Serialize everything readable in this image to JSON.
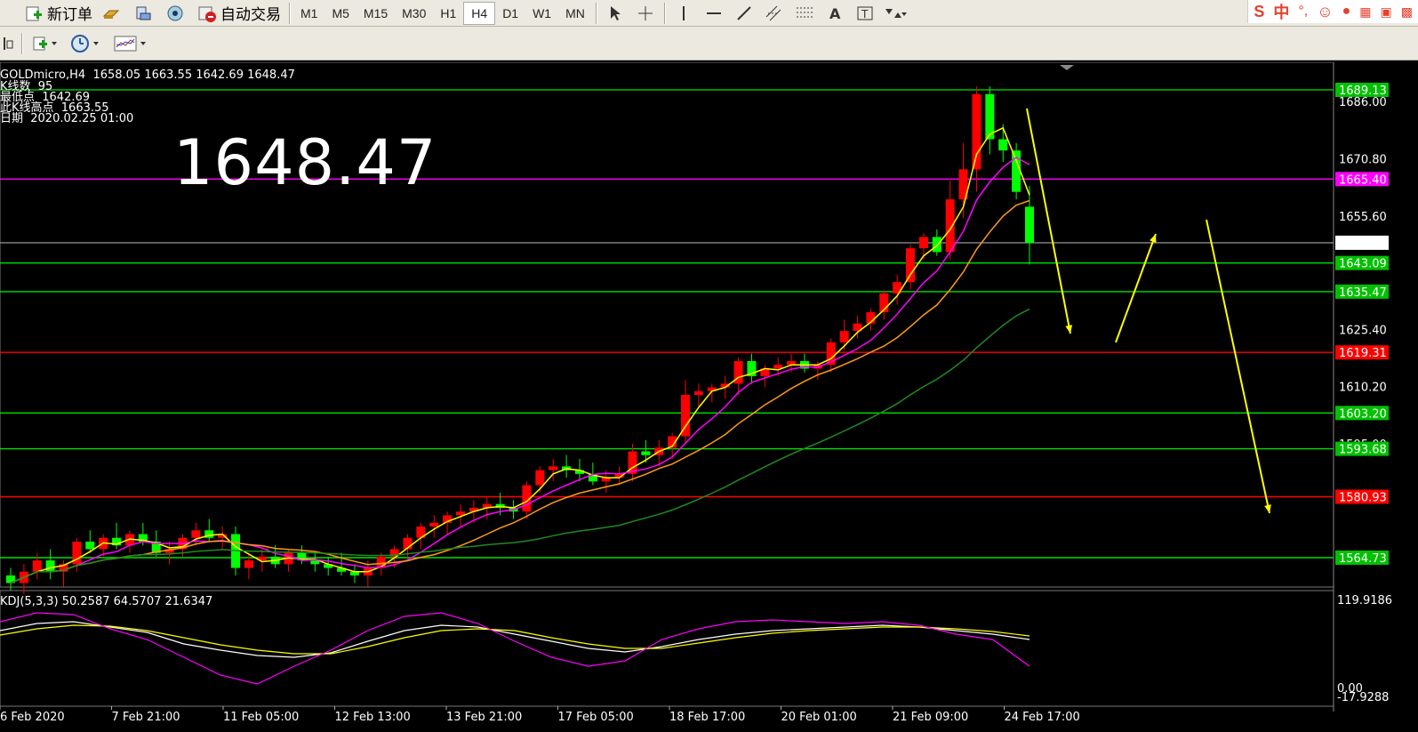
{
  "toolbar1": {
    "new_order_label": "新订单",
    "auto_trade_label": "自动交易",
    "timeframes": [
      "M1",
      "M5",
      "M15",
      "M30",
      "H1",
      "H4",
      "D1",
      "W1",
      "MN"
    ],
    "active_timeframe": "H4",
    "ime_label": "中"
  },
  "chart": {
    "header": "GOLDmicro,H4  1658.05 1663.55 1642.69 1648.47",
    "info_lines": [
      "K线数  95",
      "最低点  1642.69",
      "此K线高点  1663.55",
      "日期  2020.02.25 01:00"
    ],
    "big_price": "1648.47",
    "price_labels": [
      {
        "text": "1689.13",
        "value": 1689.13,
        "bg": "#00c000"
      },
      {
        "text": "1686.00",
        "value": 1686.0,
        "bg": null
      },
      {
        "text": "1670.80",
        "value": 1670.8,
        "bg": null
      },
      {
        "text": "1665.40",
        "value": 1665.4,
        "bg": "#ff00ff"
      },
      {
        "text": "1655.60",
        "value": 1655.6,
        "bg": null
      },
      {
        "text": "1648.47",
        "value": 1648.47,
        "bg": "#ffffff"
      },
      {
        "text": "1643.09",
        "value": 1643.09,
        "bg": "#00c000"
      },
      {
        "text": "1635.47",
        "value": 1635.47,
        "bg": "#00c000"
      },
      {
        "text": "1625.40",
        "value": 1625.4,
        "bg": null
      },
      {
        "text": "1619.31",
        "value": 1619.31,
        "bg": "#ff0000"
      },
      {
        "text": "1610.20",
        "value": 1610.2,
        "bg": null
      },
      {
        "text": "1603.20",
        "value": 1603.2,
        "bg": "#00c000"
      },
      {
        "text": "1595.00",
        "value": 1595.0,
        "bg": null
      },
      {
        "text": "1593.68",
        "value": 1593.68,
        "bg": "#00c000"
      },
      {
        "text": "1580.93",
        "value": 1580.93,
        "bg": "#ff0000"
      },
      {
        "text": "1564.73",
        "value": 1564.73,
        "bg": "#00c000"
      }
    ],
    "hlines": [
      {
        "value": 1689.13,
        "color": "#00c000"
      },
      {
        "value": 1665.4,
        "color": "#ff00ff"
      },
      {
        "value": 1648.47,
        "color": "#8a8a8a"
      },
      {
        "value": 1643.09,
        "color": "#00e000"
      },
      {
        "value": 1635.47,
        "color": "#00e000"
      },
      {
        "value": 1619.31,
        "color": "#ff0000"
      },
      {
        "value": 1603.2,
        "color": "#00e000"
      },
      {
        "value": 1593.68,
        "color": "#00e000"
      },
      {
        "value": 1580.93,
        "color": "#ff0000"
      },
      {
        "value": 1564.73,
        "color": "#00e000"
      }
    ],
    "time_labels": [
      "6 Feb 2020",
      "7 Feb 21:00",
      "11 Feb 05:00",
      "12 Feb 13:00",
      "13 Feb 21:00",
      "17 Feb 05:00",
      "18 Feb 17:00",
      "20 Feb 01:00",
      "21 Feb 09:00",
      "24 Feb 17:00"
    ],
    "kdj": {
      "label": "KDJ(5,3,3) 50.2587 64.5707 21.6347",
      "axis_top": "119.9186",
      "axis_zero": "0.00",
      "axis_bottom": "-17.9288"
    }
  },
  "chart_data": {
    "type": "candlestick",
    "symbol": "GOLDmicro",
    "timeframe": "H4",
    "ylim": [
      1553,
      1695
    ],
    "ohlc": [
      [
        1560,
        1562,
        1556,
        1558
      ],
      [
        1558,
        1563,
        1555,
        1561
      ],
      [
        1561,
        1566,
        1559,
        1564
      ],
      [
        1564,
        1567,
        1559,
        1561
      ],
      [
        1561,
        1564,
        1557,
        1563
      ],
      [
        1563,
        1570,
        1561,
        1569
      ],
      [
        1569,
        1572,
        1566,
        1567
      ],
      [
        1567,
        1571,
        1565,
        1570
      ],
      [
        1570,
        1574,
        1567,
        1568
      ],
      [
        1568,
        1572,
        1566,
        1571
      ],
      [
        1571,
        1574,
        1568,
        1569
      ],
      [
        1569,
        1572,
        1565,
        1566
      ],
      [
        1566,
        1569,
        1563,
        1567
      ],
      [
        1567,
        1571,
        1565,
        1570
      ],
      [
        1570,
        1574,
        1568,
        1572
      ],
      [
        1572,
        1575,
        1569,
        1570
      ],
      [
        1570,
        1573,
        1567,
        1571
      ],
      [
        1571,
        1573,
        1560,
        1562
      ],
      [
        1562,
        1566,
        1559,
        1564
      ],
      [
        1564,
        1567,
        1561,
        1565
      ],
      [
        1565,
        1568,
        1562,
        1563
      ],
      [
        1563,
        1567,
        1561,
        1566
      ],
      [
        1566,
        1568,
        1563,
        1564
      ],
      [
        1564,
        1566,
        1561,
        1563
      ],
      [
        1563,
        1565,
        1560,
        1562
      ],
      [
        1562,
        1566,
        1560,
        1561
      ],
      [
        1561,
        1563,
        1558,
        1560
      ],
      [
        1560,
        1564,
        1557,
        1562
      ],
      [
        1562,
        1566,
        1560,
        1565
      ],
      [
        1565,
        1568,
        1562,
        1567
      ],
      [
        1567,
        1571,
        1565,
        1570
      ],
      [
        1570,
        1574,
        1567,
        1573
      ],
      [
        1573,
        1576,
        1570,
        1574
      ],
      [
        1574,
        1577,
        1571,
        1576
      ],
      [
        1576,
        1579,
        1573,
        1577
      ],
      [
        1577,
        1580,
        1574,
        1578
      ],
      [
        1578,
        1581,
        1575,
        1579
      ],
      [
        1579,
        1582,
        1576,
        1578
      ],
      [
        1578,
        1580,
        1575,
        1577
      ],
      [
        1577,
        1585,
        1575,
        1584
      ],
      [
        1584,
        1589,
        1582,
        1588
      ],
      [
        1588,
        1591,
        1585,
        1589
      ],
      [
        1589,
        1592,
        1586,
        1588
      ],
      [
        1588,
        1591,
        1585,
        1587
      ],
      [
        1587,
        1590,
        1584,
        1585
      ],
      [
        1585,
        1588,
        1582,
        1586
      ],
      [
        1586,
        1589,
        1584,
        1587
      ],
      [
        1587,
        1595,
        1585,
        1593
      ],
      [
        1593,
        1596,
        1590,
        1592
      ],
      [
        1592,
        1596,
        1589,
        1594
      ],
      [
        1594,
        1598,
        1591,
        1597
      ],
      [
        1597,
        1612,
        1595,
        1608
      ],
      [
        1608,
        1611,
        1605,
        1609
      ],
      [
        1609,
        1611,
        1606,
        1610
      ],
      [
        1610,
        1613,
        1607,
        1611
      ],
      [
        1611,
        1618,
        1608,
        1617
      ],
      [
        1617,
        1619,
        1611,
        1613
      ],
      [
        1613,
        1616,
        1610,
        1615
      ],
      [
        1615,
        1618,
        1613,
        1616
      ],
      [
        1616,
        1619,
        1614,
        1617
      ],
      [
        1617,
        1619,
        1614,
        1615
      ],
      [
        1615,
        1617,
        1612,
        1616
      ],
      [
        1616,
        1623,
        1614,
        1622
      ],
      [
        1622,
        1628,
        1620,
        1625
      ],
      [
        1625,
        1629,
        1623,
        1627
      ],
      [
        1627,
        1631,
        1625,
        1630
      ],
      [
        1630,
        1636,
        1628,
        1635
      ],
      [
        1635,
        1640,
        1632,
        1638
      ],
      [
        1638,
        1648,
        1636,
        1647
      ],
      [
        1647,
        1651,
        1644,
        1650
      ],
      [
        1650,
        1652,
        1645,
        1646
      ],
      [
        1646,
        1665,
        1644,
        1660
      ],
      [
        1660,
        1675,
        1655,
        1668
      ],
      [
        1668,
        1690,
        1662,
        1688
      ],
      [
        1688,
        1690,
        1672,
        1676
      ],
      [
        1676,
        1680,
        1670,
        1673
      ],
      [
        1673,
        1675,
        1660,
        1662
      ],
      [
        1658.05,
        1663.55,
        1642.69,
        1648.47
      ]
    ],
    "kdj_values": {
      "K": [
        70,
        78,
        80,
        74,
        68,
        55,
        48,
        42,
        40,
        45,
        58,
        70,
        76,
        74,
        66,
        58,
        50,
        46,
        52,
        60,
        66,
        70,
        72,
        74,
        76,
        74,
        70,
        66,
        60
      ],
      "D": [
        65,
        72,
        76,
        75,
        70,
        62,
        54,
        48,
        44,
        44,
        52,
        62,
        70,
        72,
        70,
        62,
        55,
        50,
        50,
        56,
        62,
        67,
        70,
        72,
        74,
        74,
        72,
        69,
        64
      ],
      "J": [
        80,
        90,
        88,
        72,
        60,
        40,
        20,
        10,
        30,
        48,
        70,
        86,
        90,
        78,
        58,
        40,
        30,
        36,
        60,
        72,
        80,
        82,
        80,
        78,
        80,
        76,
        66,
        60,
        30
      ]
    }
  }
}
